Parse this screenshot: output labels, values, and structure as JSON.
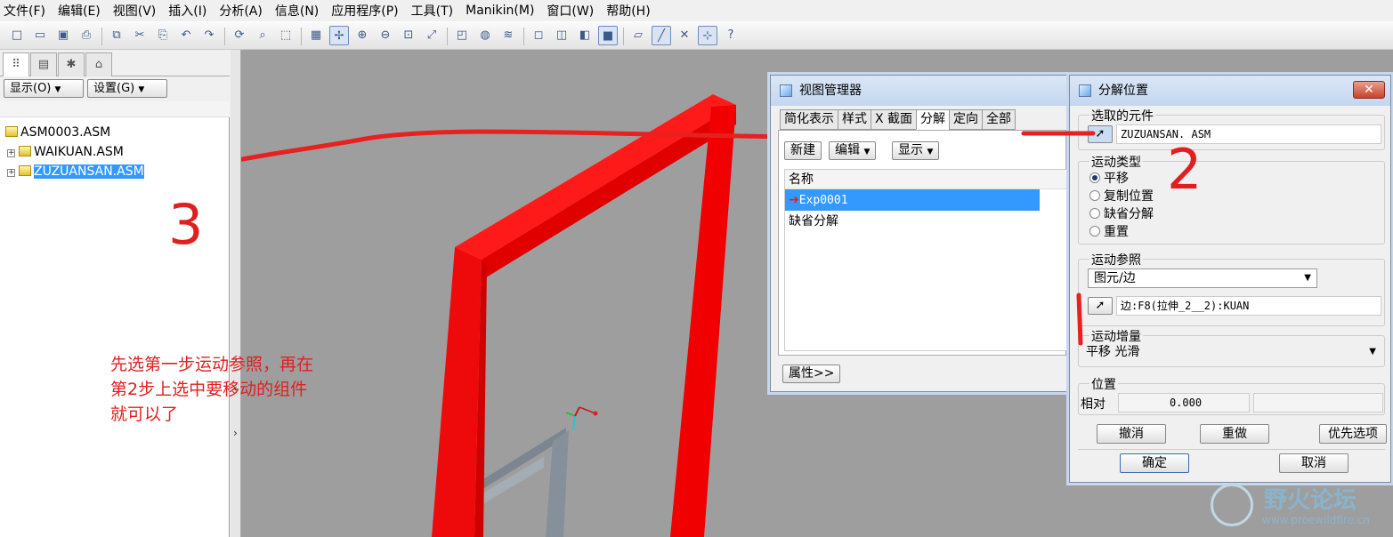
{
  "menu": [
    "文件(F)",
    "编辑(E)",
    "视图(V)",
    "插入(I)",
    "分析(A)",
    "信息(N)",
    "应用程序(P)",
    "工具(T)",
    "Manikin(M)",
    "窗口(W)",
    "帮助(H)"
  ],
  "toolbar_icons": [
    "new-file-icon",
    "open-folder-icon",
    "save-icon",
    "print-icon",
    "copy-icon",
    "cut-icon",
    "paste-icon",
    "undo-icon",
    "redo-icon",
    "regenerate-icon",
    "find-icon",
    "select-box-icon",
    "repaint-icon",
    "spin-center-icon",
    "zoom-in-icon",
    "zoom-out-icon",
    "refit-icon",
    "orient-icon",
    "saved-views-icon",
    "appearance-icon",
    "layers-icon",
    "wireframe-icon",
    "hidden-line-icon",
    "no-hidden-icon",
    "shading-icon",
    "datum-planes-icon",
    "datum-axes-icon",
    "datum-points-icon",
    "coord-sys-icon",
    "whats-this-icon"
  ],
  "left_panel": {
    "tabs": [
      "model-tree-icon",
      "folder-browser-icon",
      "favorites-icon",
      "connections-icon"
    ],
    "show_button": "显示(O)",
    "settings_button": "设置(G)",
    "tree": [
      {
        "label": "ASM0003.ASM",
        "level": 0,
        "selected": false
      },
      {
        "label": "WAIKUAN.ASM",
        "level": 1,
        "selected": false
      },
      {
        "label": "ZUZUANSAN.ASM",
        "level": 1,
        "selected": true
      }
    ]
  },
  "annotation": {
    "lines": [
      "先选第一步运动参照，再在",
      "第2步上选中要移动的组件",
      "就可以了"
    ],
    "step_numbers": [
      "3",
      "2"
    ],
    "color": "#e02020"
  },
  "view_manager": {
    "title": "视图管理器",
    "tabs": [
      "简化表示",
      "样式",
      "X 截面",
      "分解",
      "定向",
      "全部"
    ],
    "active_tab": "分解",
    "buttons": [
      "新建",
      "编辑",
      "显示"
    ],
    "list_header": "名称",
    "rows": [
      {
        "label": "Exp0001",
        "selected": true
      },
      {
        "label": "缺省分解",
        "selected": false
      }
    ],
    "properties_button": "属性>>"
  },
  "explode_dialog": {
    "title": "分解位置",
    "close": "✕",
    "selected_component_label": "选取的元件",
    "selected_component_value": "ZUZUANSAN. ASM",
    "motion_type_label": "运动类型",
    "motion_types": [
      {
        "label": "平移",
        "checked": true
      },
      {
        "label": "复制位置",
        "checked": false
      },
      {
        "label": "缺省分解",
        "checked": false
      },
      {
        "label": "重置",
        "checked": false
      }
    ],
    "motion_ref_label": "运动参照",
    "motion_ref_select": "图元/边",
    "motion_ref_value": "边:F8(拉伸_2__2):KUAN",
    "motion_inc_label": "运动增量",
    "motion_inc_select": "平移 光滑",
    "position_label": "位置",
    "relative_label": "相对",
    "relative_value": "0.000",
    "undo": "撤消",
    "redo": "重做",
    "preferences": "优先选项",
    "ok": "确定",
    "cancel": "取消"
  },
  "watermark": {
    "title": "野火论坛",
    "url": "www.proewildfire.cn"
  },
  "colors": {
    "frame_red": "#ff0a0a",
    "viewport": "#9e9e9e",
    "selection": "#3399ff"
  }
}
